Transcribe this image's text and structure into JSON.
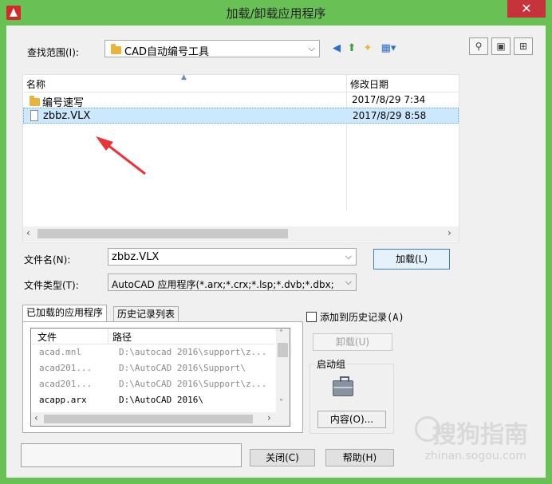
{
  "window": {
    "title": "加载/卸载应用程序",
    "close_glyph": "✕"
  },
  "lookin": {
    "label": "查找范围(I):",
    "value": "CAD自动编号工具"
  },
  "toolbar_icons": [
    "back-icon",
    "up-folder-icon",
    "new-folder-icon",
    "views-icon"
  ],
  "side_buttons": [
    "find-icon",
    "locations-icon",
    "add-favorites-icon"
  ],
  "filelist": {
    "col_name": "名称",
    "col_date": "修改日期",
    "rows": [
      {
        "name": "编号速写",
        "date": "2017/8/29 7:34",
        "type": "folder"
      },
      {
        "name": "zbbz.VLX",
        "date": "2017/8/29 8:58",
        "type": "file",
        "selected": true
      }
    ]
  },
  "filename": {
    "label": "文件名(N):",
    "value": "zbbz.VLX"
  },
  "filetype": {
    "label": "文件类型(T):",
    "value": "AutoCAD 应用程序(*.arx;*.crx;*.lsp;*.dvb;*.dbx;"
  },
  "load_button": "加载(L)",
  "tabs": {
    "loaded": "已加载的应用程序",
    "history": "历史记录列表"
  },
  "loaded_list": {
    "col_file": "文件",
    "col_path": "路径",
    "rows": [
      {
        "file": "acad.mnl",
        "path": "D:\\autocad 2016\\support\\z...",
        "grey": true
      },
      {
        "file": "acad201...",
        "path": "D:\\AutoCAD 2016\\Support\\",
        "grey": true
      },
      {
        "file": "acad201...",
        "path": "D:\\AutoCAD 2016\\Support\\z...",
        "grey": true
      },
      {
        "file": "acapp.arx",
        "path": "D:\\AutoCAD 2016\\",
        "grey": false
      }
    ]
  },
  "add_history": "添加到历史记录(A)",
  "unload_button": "卸载(U)",
  "startup": {
    "label": "启动组",
    "contents_button": "内容(O)..."
  },
  "close_button": "关闭(C)",
  "help_button": "帮助(H)",
  "watermark": {
    "brand": "搜狗指南",
    "url": "zhinan.sogou.com"
  },
  "colors": {
    "frame": "#69c155",
    "close": "#c7333a",
    "selection": "#cce8ff",
    "arrow": "#e8353a"
  }
}
